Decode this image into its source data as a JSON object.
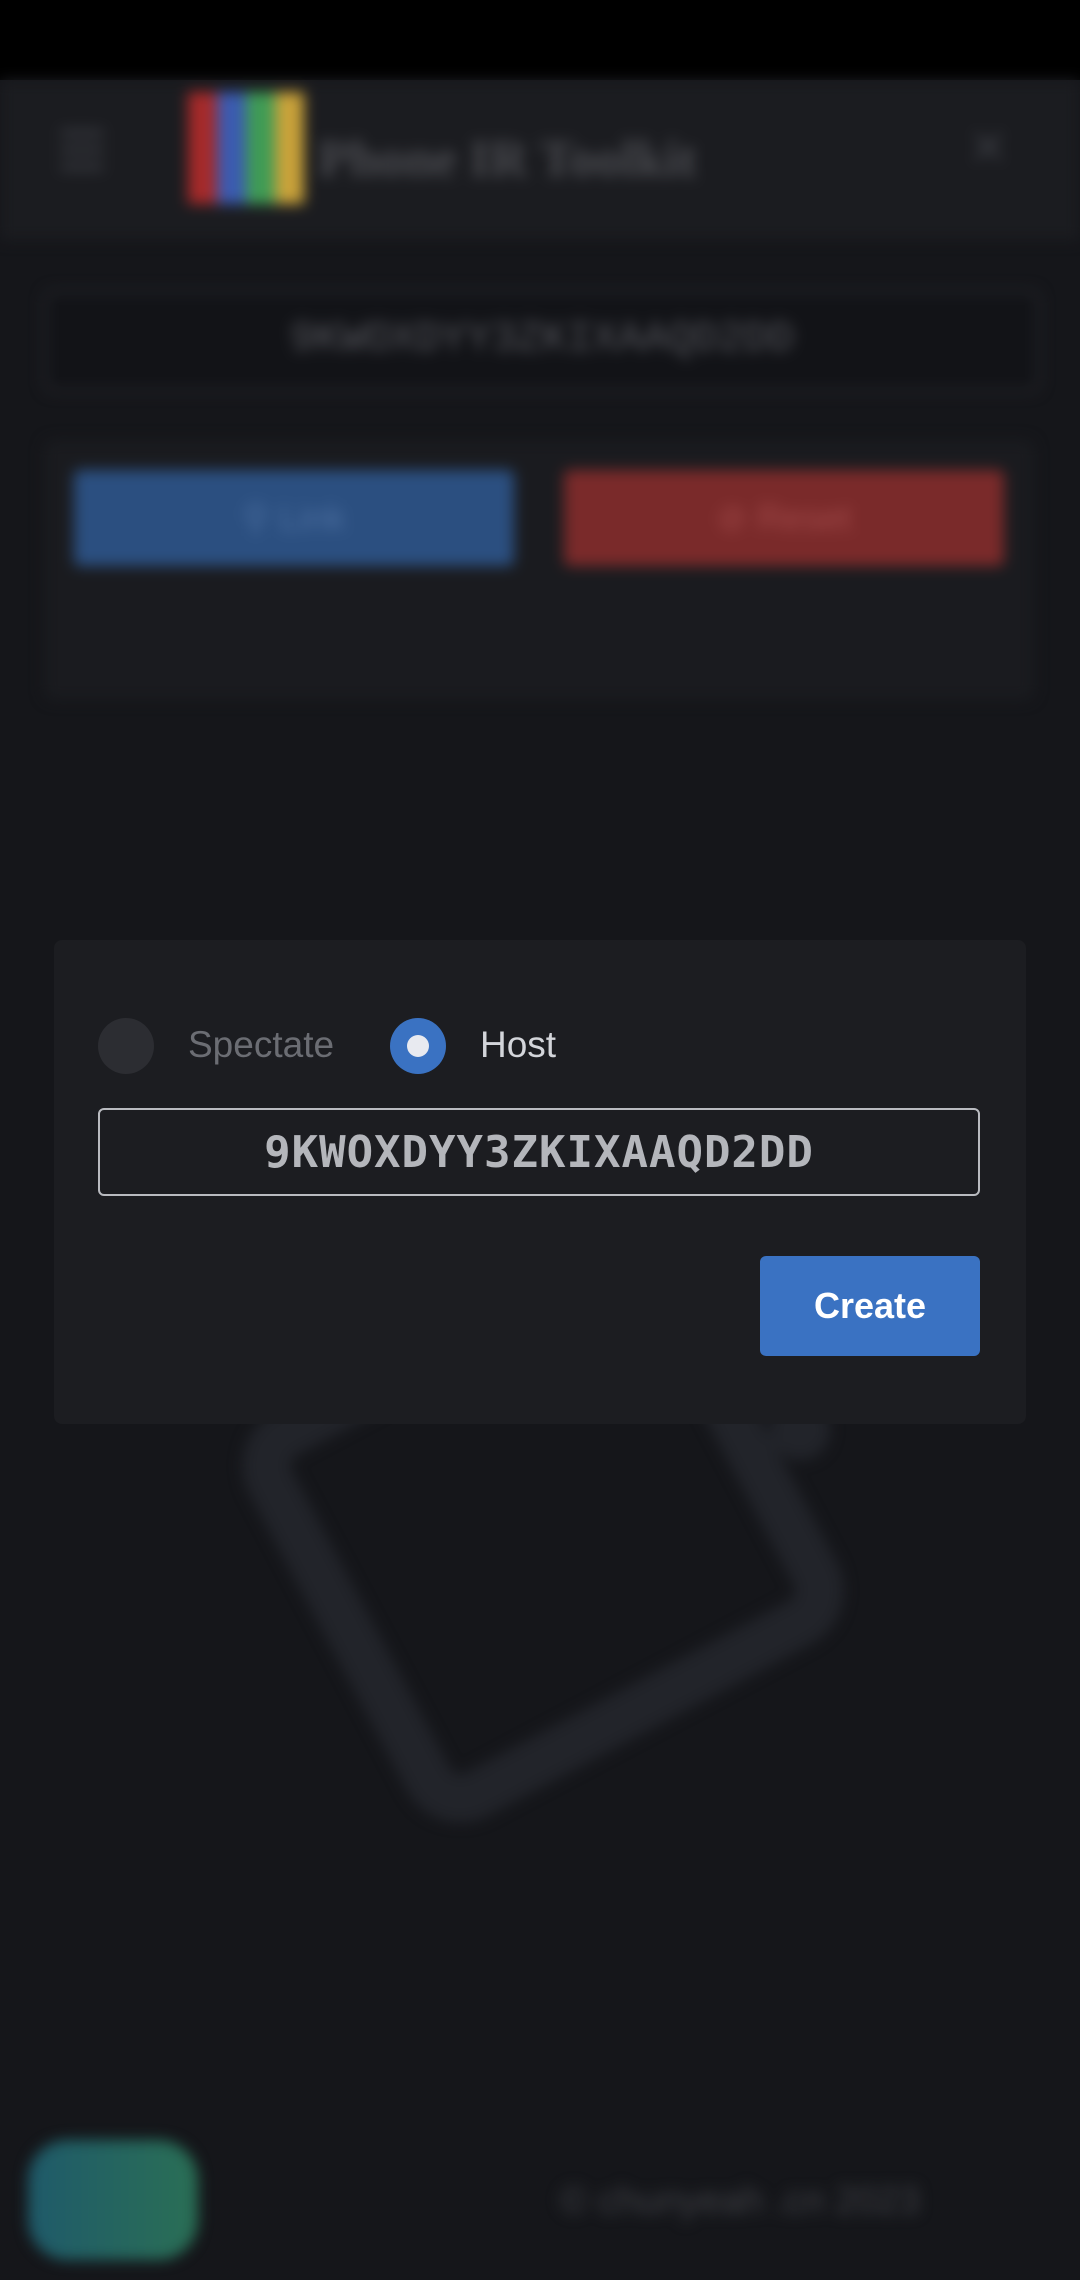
{
  "header": {
    "title": "Phone IR Toolkit",
    "menu_icon": "menu-icon",
    "close_icon": "close-icon",
    "logo_colors": [
      "#a52a2a",
      "#3b5bb0",
      "#3f9b55",
      "#c9a23a"
    ]
  },
  "background": {
    "session_code": "9KWOXDYY3ZKIXAAQD2DD",
    "link_label": "Link",
    "reset_label": "Reset",
    "footer_text": "© chunyeah .cn 2023"
  },
  "dialog": {
    "spectate_label": "Spectate",
    "host_label": "Host",
    "selected_mode": "Host",
    "code_value": "9KWOXDYY3ZKIXAAQD2DD",
    "create_label": "Create"
  },
  "colors": {
    "accent": "#3a72c2",
    "dialog_bg": "#1c1d21",
    "page_bg": "#15161a"
  }
}
